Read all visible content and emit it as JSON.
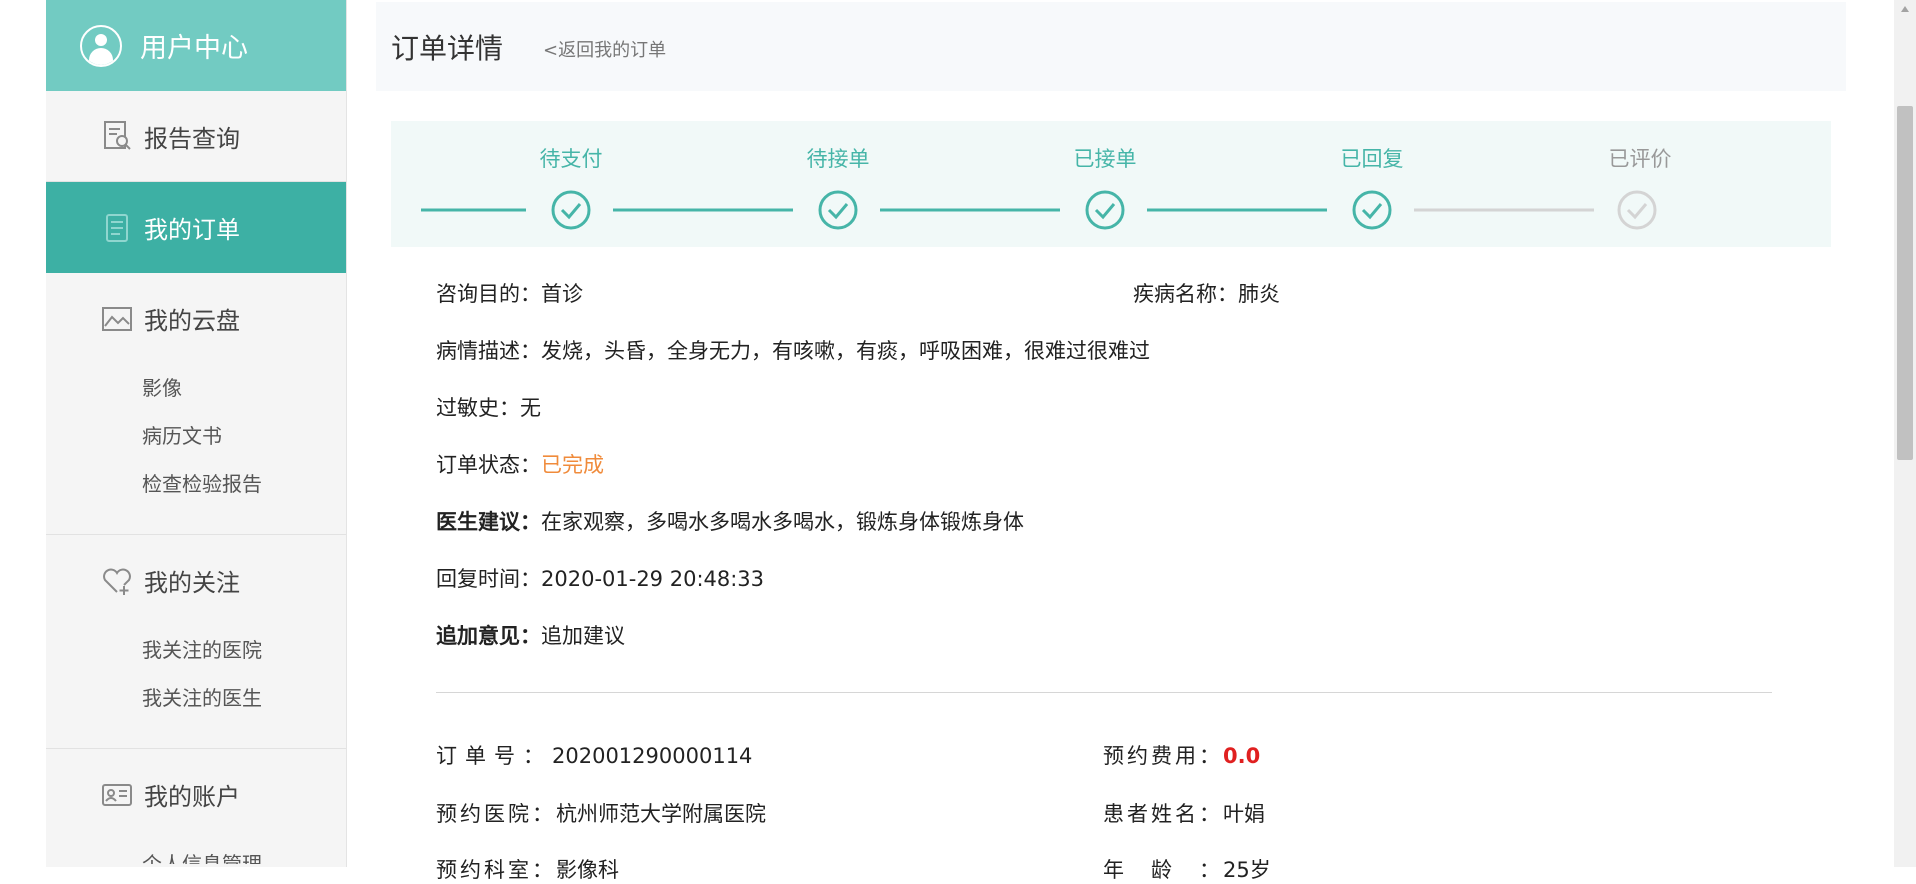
{
  "sidebar": {
    "user_center": "用户中心",
    "items": [
      {
        "label": "报告查询"
      },
      {
        "label": "我的订单"
      },
      {
        "label": "我的云盘",
        "children": [
          "影像",
          "病历文书",
          "检查检验报告"
        ]
      },
      {
        "label": "我的关注",
        "children": [
          "我关注的医院",
          "我关注的医生"
        ]
      },
      {
        "label": "我的账户",
        "children": [
          "个人信息管理"
        ]
      }
    ]
  },
  "header": {
    "title": "订单详情",
    "back_link": "<返回我的订单"
  },
  "steps": [
    {
      "label": "待支付",
      "done": true
    },
    {
      "label": "待接单",
      "done": true
    },
    {
      "label": "已接单",
      "done": true
    },
    {
      "label": "已回复",
      "done": true
    },
    {
      "label": "已评价",
      "done": false
    }
  ],
  "detail": {
    "purpose_label": "咨询目的：",
    "purpose": "首诊",
    "disease_label": "疾病名称：",
    "disease": "肺炎",
    "desc_label": "病情描述：",
    "desc": "发烧，头昏，全身无力，有咳嗽，有痰，呼吸困难，很难过很难过",
    "allergy_label": "过敏史：",
    "allergy": "无",
    "status_label": "订单状态：",
    "status": "已完成",
    "advice_label": "医生建议：",
    "advice": "在家观察，多喝水多喝水多喝水，锻炼身体锻炼身体",
    "reply_time_label": "回复时间：",
    "reply_time": "2020-01-29 20:48:33",
    "extra_label": "追加意见：",
    "extra": "追加建议"
  },
  "order": {
    "no_label": "订单号：",
    "no": "202001290000114",
    "fee_label": "预约费用：",
    "fee": "0.0",
    "hospital_label": "预约医院：",
    "hospital": "杭州师范大学附属医院",
    "patient_label": "患者姓名：",
    "patient": "叶娟",
    "dept_label": "预约科室：",
    "dept": "影像科",
    "age_label": "年　龄　：",
    "age": "25岁"
  },
  "colors": {
    "accent": "#3db0a4",
    "accent_light": "#72cbc2",
    "status": "#f08b3b",
    "fee": "#e02020"
  }
}
